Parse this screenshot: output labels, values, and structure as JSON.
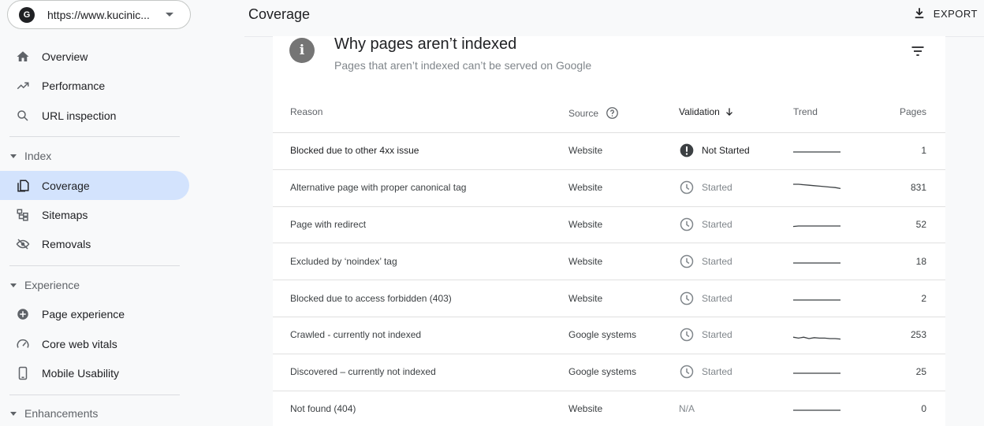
{
  "sidebar": {
    "property": {
      "logo": "G",
      "url": "https://www.kucinic..."
    },
    "items": {
      "overview": "Overview",
      "performance": "Performance",
      "url_inspection": "URL inspection",
      "coverage": "Coverage",
      "sitemaps": "Sitemaps",
      "removals": "Removals",
      "page_experience": "Page experience",
      "core_web_vitals": "Core web vitals",
      "mobile_usability": "Mobile Usability"
    },
    "sections": {
      "index": "Index",
      "experience": "Experience",
      "enhancements": "Enhancements"
    }
  },
  "header": {
    "title": "Coverage",
    "export_label": "EXPORT"
  },
  "card": {
    "info_glyph": "i",
    "title": "Why pages aren’t indexed",
    "subtitle": "Pages that aren’t indexed can’t be served on Google",
    "columns": {
      "reason": "Reason",
      "source": "Source",
      "validation": "Validation",
      "trend": "Trend",
      "pages": "Pages"
    },
    "rows": [
      {
        "reason": "Blocked due to other 4xx issue",
        "source": "Website",
        "validation": "Not Started",
        "validation_icon": "exclamation-icon",
        "trend": [
          0,
          0,
          0,
          0,
          0,
          0,
          0,
          0,
          0,
          0
        ],
        "pages": "1"
      },
      {
        "reason": "Alternative page with proper canonical tag",
        "source": "Website",
        "validation": "Started",
        "validation_icon": "clock-icon",
        "trend": [
          0,
          0,
          0.05,
          0.1,
          0.15,
          0.2,
          0.25,
          0.3,
          0.35,
          0.45
        ],
        "pages": "831"
      },
      {
        "reason": "Page with redirect",
        "source": "Website",
        "validation": "Started",
        "validation_icon": "clock-icon",
        "trend": [
          0.05,
          0,
          0,
          0,
          0,
          0,
          0,
          0,
          0,
          0
        ],
        "pages": "52"
      },
      {
        "reason": "Excluded by ‘noindex’ tag",
        "source": "Website",
        "validation": "Started",
        "validation_icon": "clock-icon",
        "trend": [
          0,
          0,
          0,
          0,
          0,
          0,
          0,
          0,
          0,
          0
        ],
        "pages": "18"
      },
      {
        "reason": "Blocked due to access forbidden (403)",
        "source": "Website",
        "validation": "Started",
        "validation_icon": "clock-icon",
        "trend": [
          0,
          0,
          0,
          0,
          0,
          0,
          0,
          0,
          0,
          0
        ],
        "pages": "2"
      },
      {
        "reason": "Crawled - currently not indexed",
        "source": "Google systems",
        "validation": "Started",
        "validation_icon": "clock-icon",
        "trend": [
          0.1,
          0.2,
          0.1,
          0.25,
          0.15,
          0.2,
          0.2,
          0.25,
          0.25,
          0.3
        ],
        "pages": "253"
      },
      {
        "reason": "Discovered – currently not indexed",
        "source": "Google systems",
        "validation": "Started",
        "validation_icon": "clock-icon",
        "trend": [
          0,
          0,
          0,
          0,
          0,
          0,
          0,
          0,
          0,
          0
        ],
        "pages": "25"
      },
      {
        "reason": "Not found (404)",
        "source": "Website",
        "validation": "N/A",
        "validation_icon": "",
        "trend": [
          0,
          0,
          0,
          0,
          0,
          0,
          0,
          0,
          0,
          0
        ],
        "pages": "0"
      }
    ]
  },
  "colors": {
    "active_nav": "#d3e3fd",
    "muted_text": "#80868b",
    "status_dark": "#3c4043"
  }
}
